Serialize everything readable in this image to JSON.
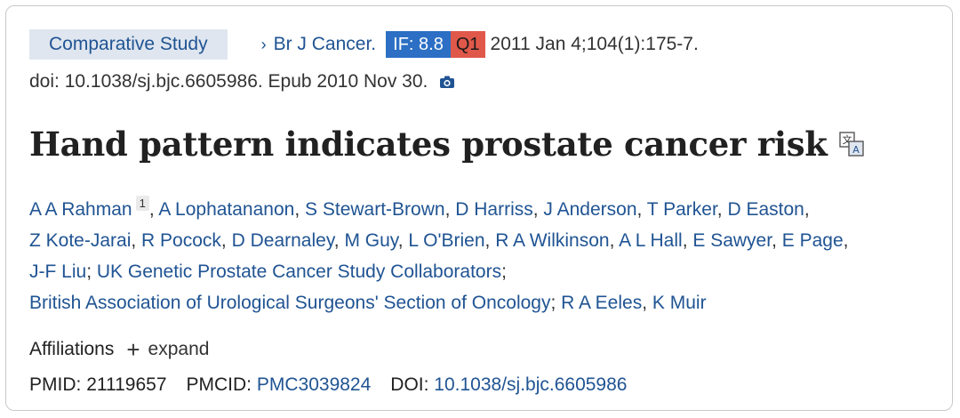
{
  "header": {
    "article_type": "Comparative Study",
    "journal": "Br J Cancer.",
    "impact_factor": "IF: 8.8",
    "quartile": "Q1",
    "citation": "2011 Jan 4;104(1):175-7.",
    "doi_epub": "doi: 10.1038/sj.bjc.6605986. Epub 2010 Nov 30."
  },
  "title": "Hand pattern indicates prostate cancer risk",
  "authors": {
    "first": "A A Rahman",
    "first_affiliation": "1",
    "list": [
      "A Lophatananon",
      "S Stewart-Brown",
      "D Harriss",
      "J Anderson",
      "T Parker",
      "D Easton",
      "Z Kote-Jarai",
      "R Pocock",
      "D Dearnaley",
      "M Guy",
      "L O'Brien",
      "R A Wilkinson",
      "A L Hall",
      "E Sawyer",
      "E Page",
      "J-F Liu"
    ],
    "collab1": "UK Genetic Prostate Cancer Study Collaborators",
    "collab2": "British Association of Urological Surgeons' Section of Oncology",
    "last": [
      "R A Eeles",
      "K Muir"
    ]
  },
  "affiliations": {
    "label": "Affiliations",
    "expand": "expand"
  },
  "ids": {
    "pmid_label": "PMID:",
    "pmid": "21119657",
    "pmcid_label": "PMCID:",
    "pmcid": "PMC3039824",
    "doi_label": "DOI:",
    "doi": "10.1038/sj.bjc.6605986"
  },
  "colors": {
    "link": "#205493",
    "badge_bg": "#dfe6ef",
    "if_bg": "#2c6fc4",
    "q1_bg": "#e0584a"
  },
  "icons": [
    "camera-icon",
    "translate-icon",
    "plus-icon",
    "chevron-right-icon"
  ]
}
